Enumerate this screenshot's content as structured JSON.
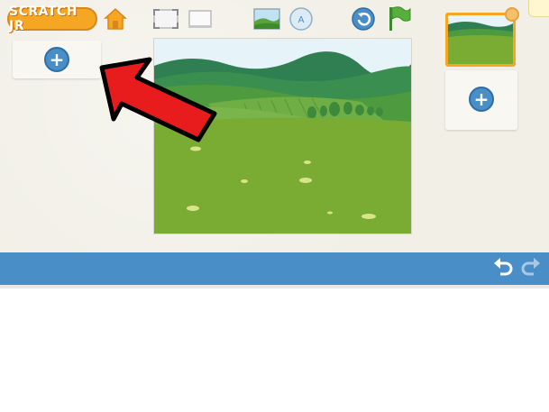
{
  "app": {
    "logo_text": "SCRATCH JR",
    "accent_color": "#f5a623",
    "primary_color": "#4a8ec8"
  },
  "toolbar": {
    "icons": [
      "home-icon",
      "presentation-mode-icon",
      "grid-icon",
      "background-icon",
      "title-text-icon",
      "reset-icon",
      "green-flag-icon"
    ]
  },
  "sprite_panel": {
    "add_sprite_icon": "plus-icon"
  },
  "pages": {
    "count": 1,
    "selected_index": 0,
    "add_page_icon": "plus-icon"
  },
  "bottom_bar": {
    "undo_icon": "undo-icon",
    "redo_icon": "redo-icon"
  },
  "annotation": {
    "arrow_color": "#e81c1c"
  }
}
